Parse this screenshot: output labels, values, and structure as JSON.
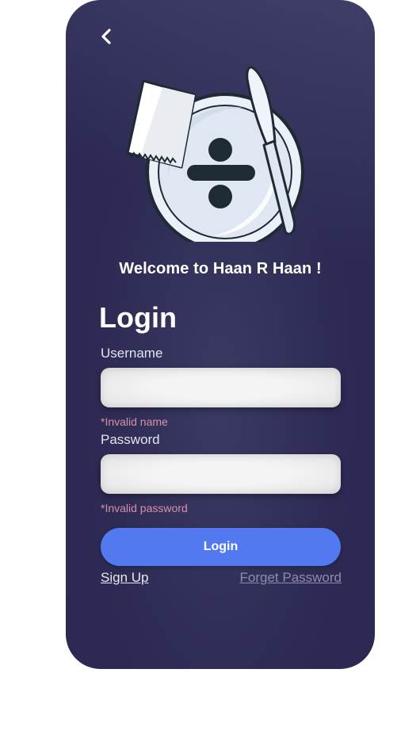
{
  "header": {
    "back_icon": "chevron-left-icon"
  },
  "hero": {
    "illustration": "plate-with-napkin-and-knife",
    "symbol": "division-sign"
  },
  "welcome_text": "Welcome to Haan R Haan !",
  "title": "Login",
  "form": {
    "username": {
      "label": "Username",
      "value": "",
      "placeholder": "",
      "error": "*Invalid name"
    },
    "password": {
      "label": "Password",
      "value": "",
      "placeholder": "",
      "error": "*Invalid password"
    },
    "submit_label": "Login"
  },
  "links": {
    "sign_up": "Sign Up",
    "forget_password": "Forget Password"
  },
  "colors": {
    "background": "#2e2c55",
    "primary_button": "#5279f0",
    "error_text": "#d98fa6",
    "muted_link": "#8e8cae",
    "text": "#ffffff"
  }
}
